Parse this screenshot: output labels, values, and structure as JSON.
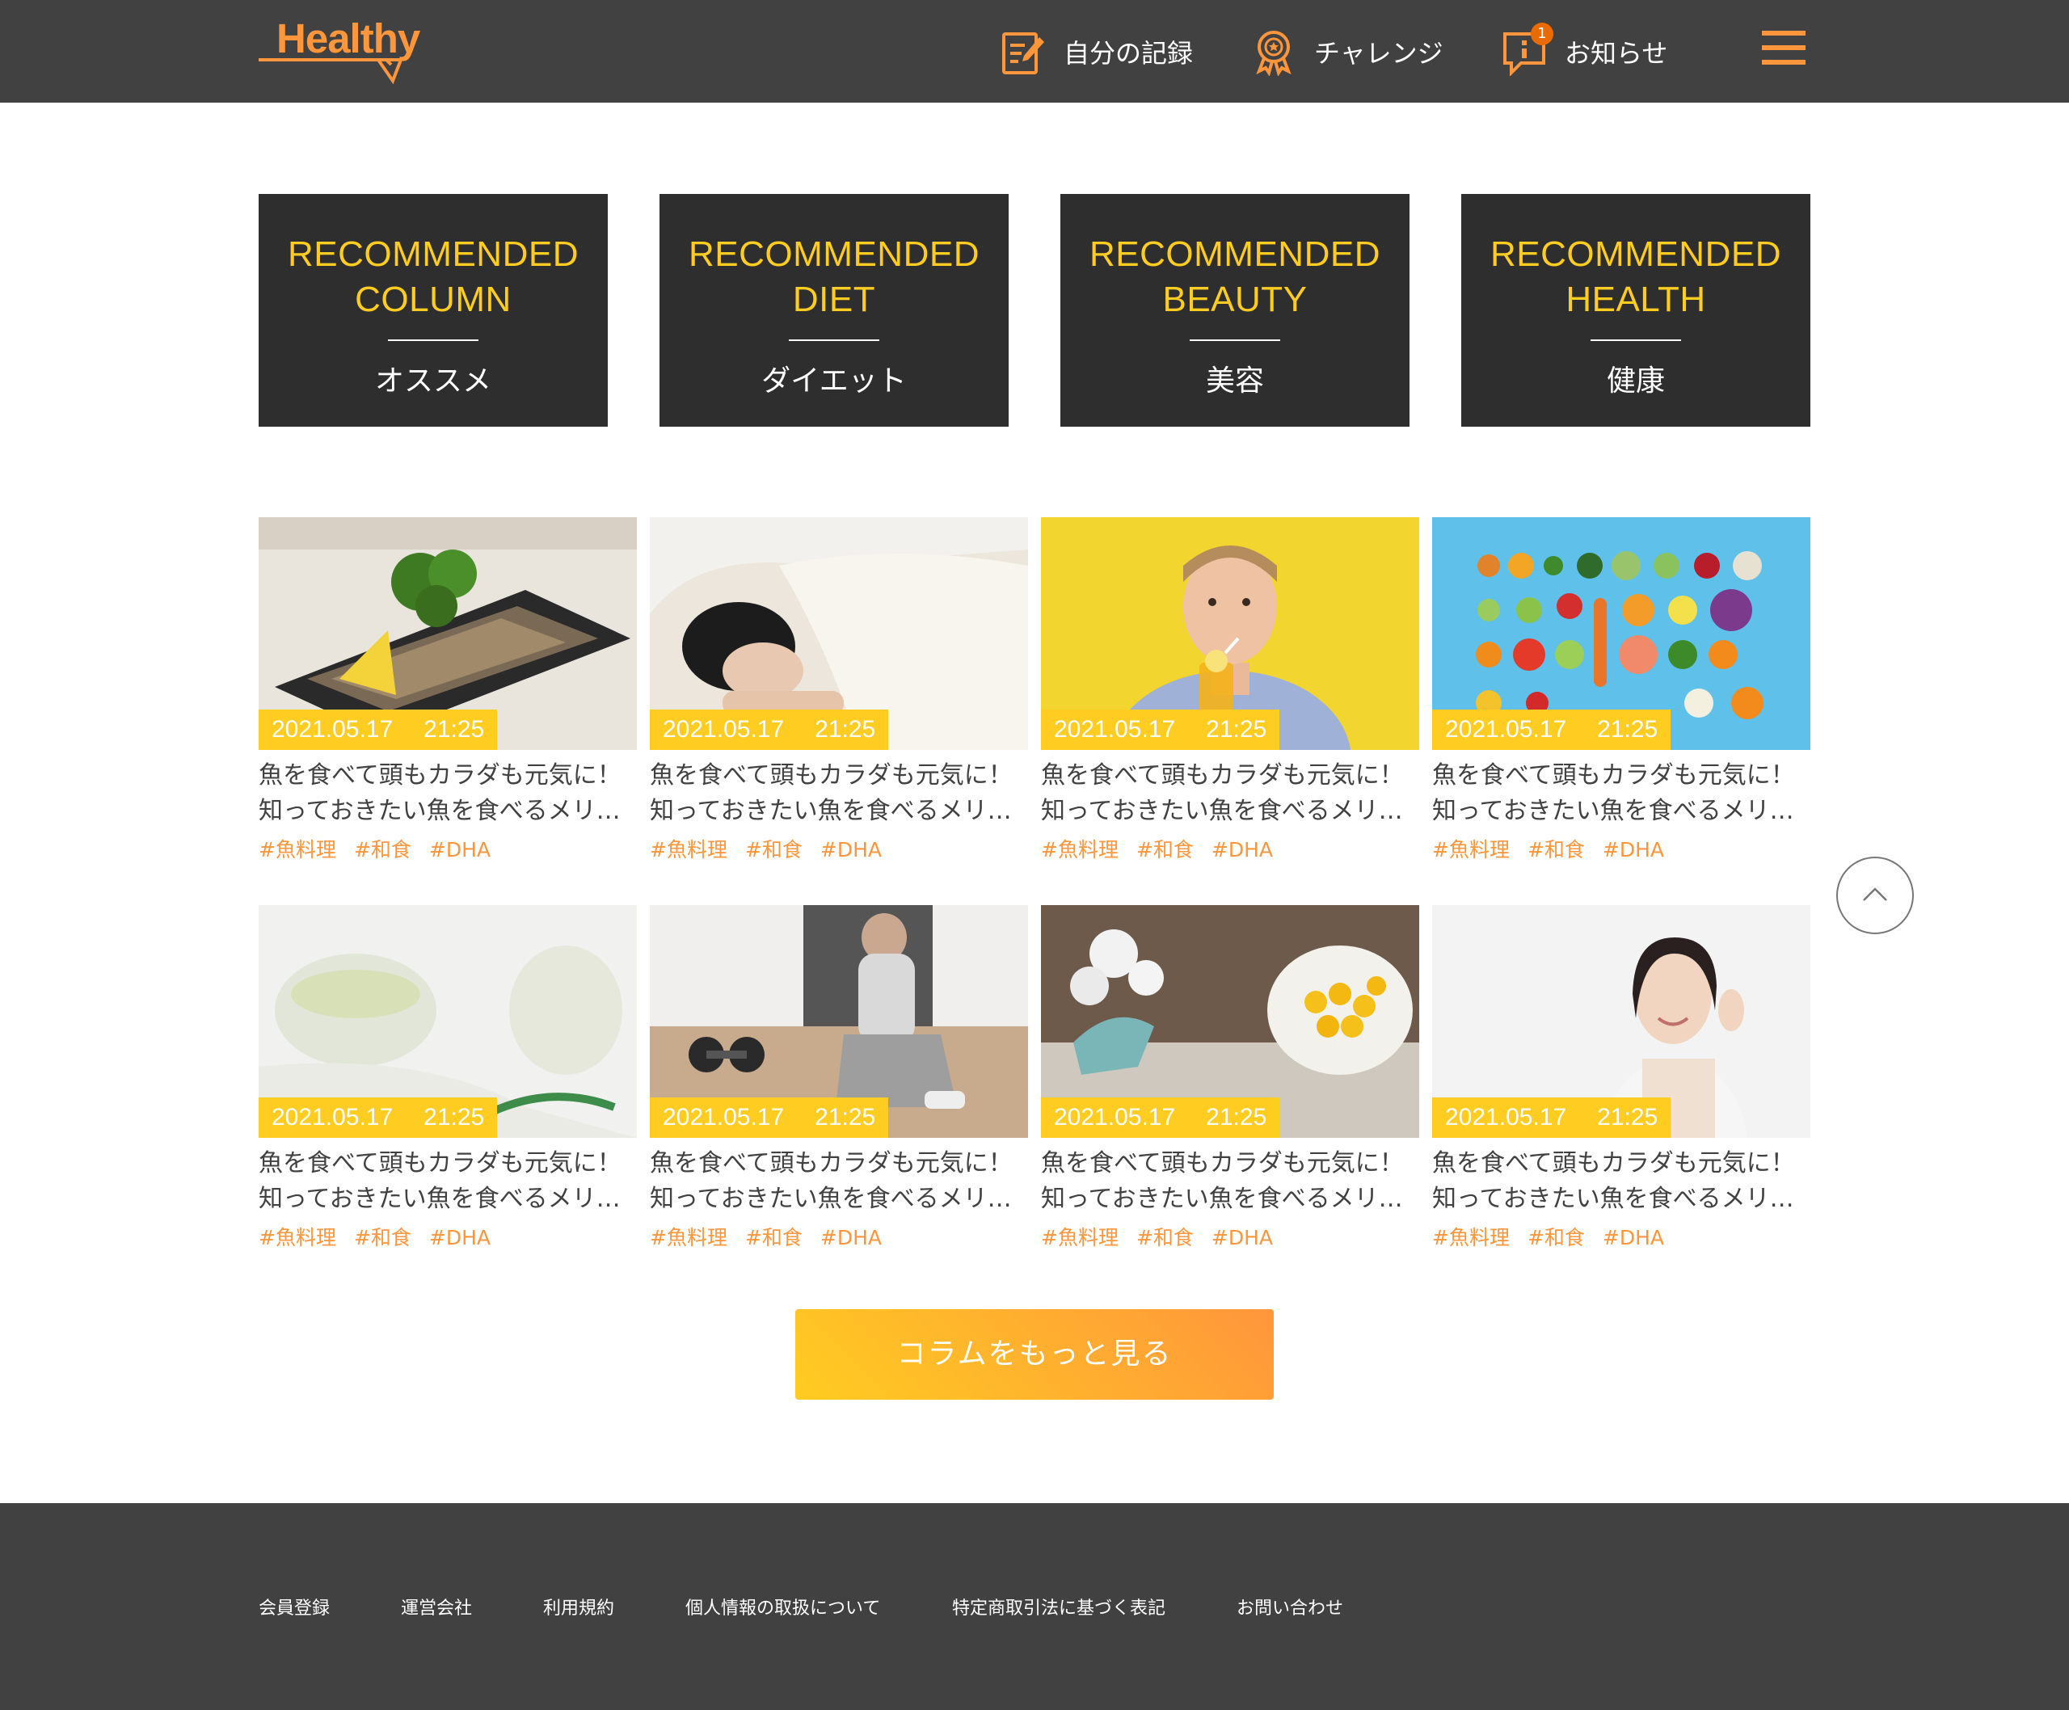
{
  "header": {
    "logo": "Healthy",
    "nav": [
      {
        "label": "自分の記録",
        "icon": "memo-icon"
      },
      {
        "label": "チャレンジ",
        "icon": "challenge-medal-icon"
      },
      {
        "label": "お知らせ",
        "icon": "info-icon",
        "badge": "1"
      }
    ],
    "menu_icon": "hamburger-menu-icon"
  },
  "categories": [
    {
      "title_line1": "RECOMMENDED",
      "title_line2": "COLUMN",
      "subtitle": "オススメ"
    },
    {
      "title_line1": "RECOMMENDED",
      "title_line2": "DIET",
      "subtitle": "ダイエット"
    },
    {
      "title_line1": "RECOMMENDED",
      "title_line2": "BEAUTY",
      "subtitle": "美容"
    },
    {
      "title_line1": "RECOMMENDED",
      "title_line2": "HEALTH",
      "subtitle": "健康"
    }
  ],
  "articles": [
    {
      "date": "2021.05.17",
      "time": "21:25",
      "title_line1": "魚を食べて頭もカラダも元気に！",
      "title_line2": "知っておきたい魚を食べるメリ…",
      "tags": [
        "#魚料理",
        "#和食",
        "#DHA"
      ],
      "image": "grilled-fish-photo"
    },
    {
      "date": "2021.05.17",
      "time": "21:25",
      "title_line1": "魚を食べて頭もカラダも元気に！",
      "title_line2": "知っておきたい魚を食べるメリ…",
      "tags": [
        "#魚料理",
        "#和食",
        "#DHA"
      ],
      "image": "sleeping-woman-photo"
    },
    {
      "date": "2021.05.17",
      "time": "21:25",
      "title_line1": "魚を食べて頭もカラダも元気に！",
      "title_line2": "知っておきたい魚を食べるメリ…",
      "tags": [
        "#魚料理",
        "#和食",
        "#DHA"
      ],
      "image": "man-drinking-juice-photo"
    },
    {
      "date": "2021.05.17",
      "time": "21:25",
      "title_line1": "魚を食べて頭もカラダも元気に！",
      "title_line2": "知っておきたい魚を食べるメリ…",
      "tags": [
        "#魚料理",
        "#和食",
        "#DHA"
      ],
      "image": "vegetables-fruits-photo"
    },
    {
      "date": "2021.05.17",
      "time": "21:25",
      "title_line1": "魚を食べて頭もカラダも元気に！",
      "title_line2": "知っておきたい魚を食べるメリ…",
      "tags": [
        "#魚料理",
        "#和食",
        "#DHA"
      ],
      "image": "herbal-tea-photo"
    },
    {
      "date": "2021.05.17",
      "time": "21:25",
      "title_line1": "魚を食べて頭もカラダも元気に！",
      "title_line2": "知っておきたい魚を食べるメリ…",
      "tags": [
        "#魚料理",
        "#和食",
        "#DHA"
      ],
      "image": "fitness-dumbbell-photo"
    },
    {
      "date": "2021.05.17",
      "time": "21:25",
      "title_line1": "魚を食べて頭もカラダも元気に！",
      "title_line2": "知っておきたい魚を食べるメリ…",
      "tags": [
        "#魚料理",
        "#和食",
        "#DHA"
      ],
      "image": "supplement-capsules-photo"
    },
    {
      "date": "2021.05.17",
      "time": "21:25",
      "title_line1": "魚を食べて頭もカラダも元気に！",
      "title_line2": "知っておきたい魚を食べるメリ…",
      "tags": [
        "#魚料理",
        "#和食",
        "#DHA"
      ],
      "image": "smiling-woman-photo"
    }
  ],
  "more_button": "コラムをもっと見る",
  "scroll_top_icon": "chevron-up-icon",
  "footer": {
    "links": [
      "会員登録",
      "運営会社",
      "利用規約",
      "個人情報の取扱について",
      "特定商取引法に基づく表記",
      "お問い合わせ"
    ]
  },
  "colors": {
    "header_bg": "#414141",
    "tile_bg": "#2E2E2E",
    "primary_yellow": "#FFCC21",
    "primary_orange": "#FF963C",
    "text": "#414141"
  }
}
